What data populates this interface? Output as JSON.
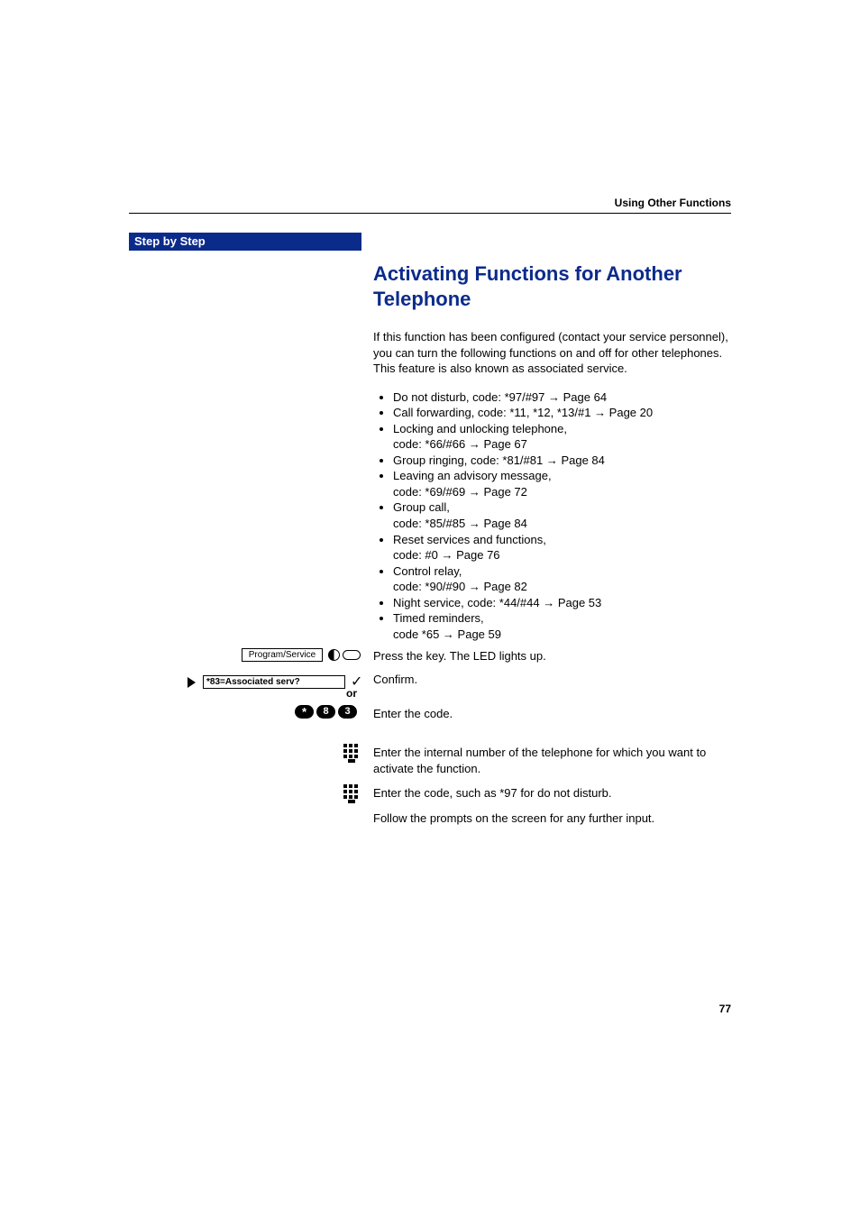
{
  "header": {
    "running_title": "Using Other Functions"
  },
  "sidebar": {
    "banner": "Step by Step"
  },
  "section": {
    "title": "Activating Functions for Another Telephone",
    "intro": "If this function has been configured (contact your service personnel), you can turn the following functions on and off for other telephones. This feature is also known as associated service."
  },
  "features": [
    {
      "text": "Do not disturb, code: *97/#97 → Page 64"
    },
    {
      "text": "Call forwarding, code: *11, *12, *13/#1 → Page 20"
    },
    {
      "text": "Locking and unlocking telephone,"
    },
    {
      "text_cont": "code: *66/#66 → Page 67"
    },
    {
      "text": "Group ringing, code: *81/#81 → Page 84"
    },
    {
      "text": "Leaving an advisory message,"
    },
    {
      "text_cont": "code: *69/#69 → Page 72"
    },
    {
      "text": "Group call,"
    },
    {
      "text_cont": "code: *85/#85 → Page 84"
    },
    {
      "text": "Reset services and functions,"
    },
    {
      "text_cont": "code: #0 → Page 76"
    },
    {
      "text": "Control relay,"
    },
    {
      "text_cont": "code: *90/#90 → Page 82"
    },
    {
      "text": "Night service, code: *44/#44 → Page 53"
    },
    {
      "text": "Timed reminders,"
    },
    {
      "text_cont": "code *65 → Page 59"
    }
  ],
  "steps": {
    "prog_label": "Program/Service",
    "assoc_label": "*83=Associated serv?",
    "or_label": "or",
    "keys": [
      "*",
      "8",
      "3"
    ],
    "press_key": "Press the key. The LED lights up.",
    "confirm": "Confirm.",
    "enter_code": "Enter the code.",
    "enter_internal": "Enter the internal number of the telephone for which you want to activate the function.",
    "enter_code2": "Enter the code, such as *97 for do not disturb.",
    "follow": "Follow the prompts on the screen for any further input."
  },
  "page_number": "77"
}
